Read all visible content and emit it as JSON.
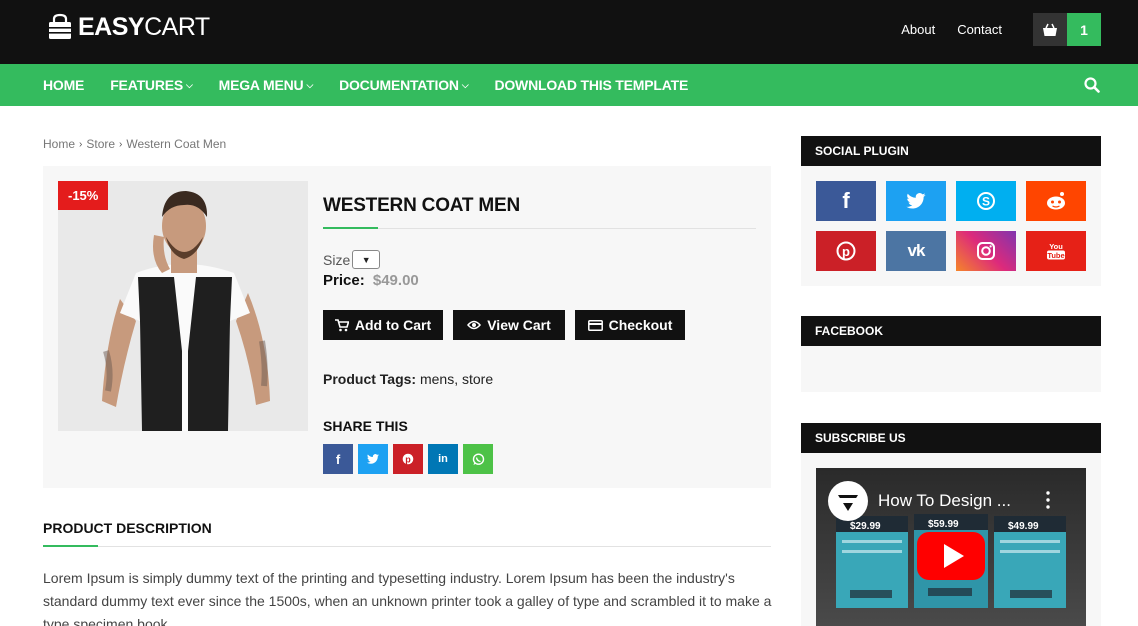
{
  "header": {
    "logo_bold": "EASY",
    "logo_light": "CART",
    "links": [
      "About",
      "Contact"
    ],
    "cart_count": "1"
  },
  "nav": {
    "items": [
      {
        "label": "HOME",
        "has_dropdown": false
      },
      {
        "label": "FEATURES",
        "has_dropdown": true
      },
      {
        "label": "MEGA MENU",
        "has_dropdown": true
      },
      {
        "label": "DOCUMENTATION",
        "has_dropdown": true
      },
      {
        "label": "DOWNLOAD THIS TEMPLATE",
        "has_dropdown": false
      }
    ],
    "search_icon": "search-icon"
  },
  "breadcrumb": [
    "Home",
    "Store",
    "Western Coat Men"
  ],
  "product": {
    "discount": "-15%",
    "title": "WESTERN COAT MEN",
    "size_label": "Size",
    "price_label": "Price:",
    "price": "$49.00",
    "buttons": {
      "add_to_cart": "Add to Cart",
      "view_cart": "View Cart",
      "checkout": "Checkout"
    },
    "tags_label": "Product Tags:",
    "tags": "mens, store",
    "share_title": "SHARE THIS",
    "share_icons": [
      "facebook-icon",
      "twitter-icon",
      "pinterest-icon",
      "linkedin-icon",
      "whatsapp-icon"
    ]
  },
  "description": {
    "title": "PRODUCT DESCRIPTION",
    "text": "Lorem Ipsum is simply dummy text of the printing and typesetting industry. Lorem Ipsum has been the industry's standard dummy text ever since the 1500s, when an unknown printer took a galley of type and scrambled it to make a type specimen book."
  },
  "sidebar": {
    "social_title": "SOCIAL PLUGIN",
    "social_icons": [
      "facebook-icon",
      "twitter-icon",
      "skype-icon",
      "reddit-icon",
      "pinterest-icon",
      "vk-icon",
      "instagram-icon",
      "youtube-icon"
    ],
    "facebook_title": "FACEBOOK",
    "subscribe_title": "SUBSCRIBE US",
    "video_title": "How To Design ...",
    "video_prices": [
      "$29.99",
      "$59.99",
      "$49.99"
    ]
  },
  "colors": {
    "accent": "#34bb5e",
    "dark": "#111111",
    "badge": "#e41c1c",
    "facebook": "#3b5998",
    "twitter": "#1da1f2",
    "skype": "#00aff0",
    "reddit": "#ff4500",
    "pinterest": "#cb2027",
    "vk": "#4c75a3",
    "youtube": "#e62117",
    "linkedin": "#0077b5",
    "whatsapp": "#4dc247"
  }
}
